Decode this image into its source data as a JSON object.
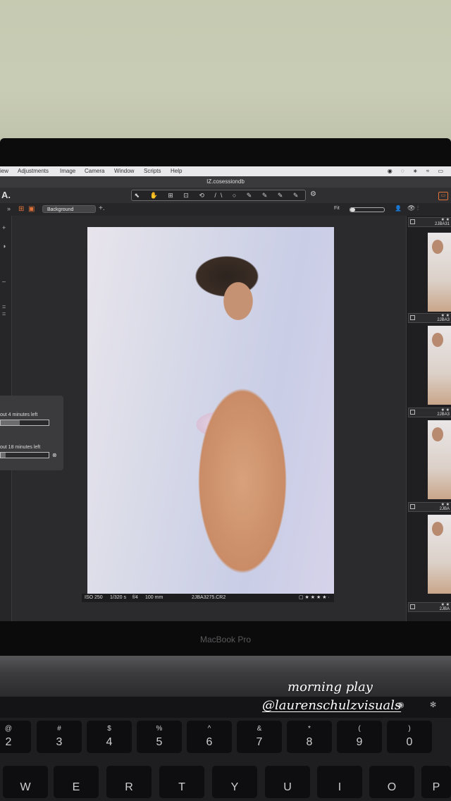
{
  "menubar": {
    "items": [
      "iew",
      "Adjustments",
      "Image",
      "Camera",
      "Window",
      "Scripts",
      "Help"
    ],
    "status_icons": "◉ ◌ ∗ ≈ ▭"
  },
  "window": {
    "title": "IZ.cosessiondb"
  },
  "toolbar": {
    "app_logo": "A.",
    "tools": "⬉ ✋ ⊞ ⊡ ⟲ /\\ ○ ✎ ✎ ✎ ✎",
    "gear": "⚙",
    "panel_toggle": "▭"
  },
  "subbar": {
    "expand": "»",
    "grid_icon": "⊞",
    "single_icon": "▣",
    "collection": "Background",
    "add": "+.",
    "fit": "Fit",
    "zoom_level": 0.15,
    "person_icon": "👤",
    "eye_icon": "👁 ⫶"
  },
  "left_tools": [
    "+",
    "◑",
    "–",
    "=",
    "="
  ],
  "progress": [
    {
      "label": "out 4 minutes left",
      "fraction": 0.4
    },
    {
      "label": "out 18 minutes left",
      "fraction": 0.1
    }
  ],
  "progress_close": "⊗",
  "photo": {
    "iso": "ISO 250",
    "shutter": "1/320 s",
    "aperture": "f/4",
    "focal": "100 mm",
    "filename": "2JBA3275.CR2",
    "rating": "▢ ★ ★ ★ ★ ·"
  },
  "browser": {
    "thumbs": [
      {
        "stars": "★ ★",
        "name": "2JBA31"
      },
      {
        "stars": "★ ★",
        "name": "2JBA3"
      },
      {
        "stars": "★ ★",
        "name": "2JBA3"
      },
      {
        "stars": "★ ★",
        "name": "2JBA"
      },
      {
        "stars": "★ ★",
        "name": "2JBA"
      }
    ]
  },
  "device": {
    "label": "MacBook Pro"
  },
  "touchbar": {
    "icon1": "◉",
    "icon2": "✻"
  },
  "keyboard": {
    "row1": [
      {
        "top": "@",
        "bot": "2"
      },
      {
        "top": "#",
        "bot": "3"
      },
      {
        "top": "$",
        "bot": "4"
      },
      {
        "top": "%",
        "bot": "5"
      },
      {
        "top": "^",
        "bot": "6"
      },
      {
        "top": "&",
        "bot": "7"
      },
      {
        "top": "*",
        "bot": "8"
      },
      {
        "top": "(",
        "bot": "9"
      },
      {
        "top": ")",
        "bot": "0"
      }
    ],
    "row2": [
      "W",
      "E",
      "R",
      "T",
      "Y",
      "U",
      "I",
      "O",
      "P"
    ]
  },
  "caption": {
    "line1": "morning play",
    "line2": "@laurenschulzvisuals"
  }
}
